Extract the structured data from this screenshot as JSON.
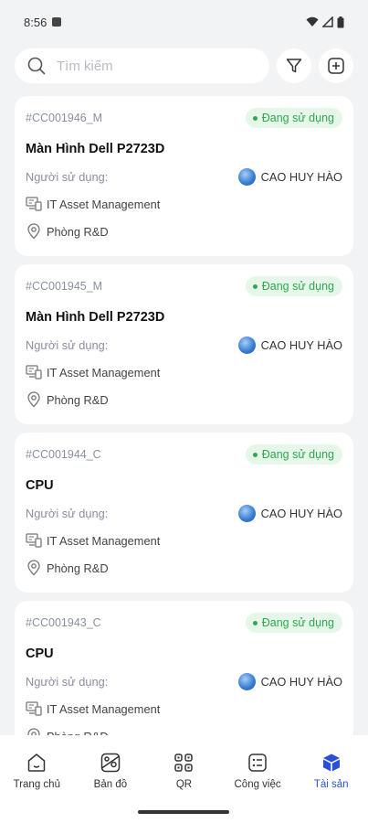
{
  "status_bar": {
    "time": "8:56"
  },
  "search": {
    "placeholder": "Tìm kiếm"
  },
  "cards": [
    {
      "code": "#CC001946_M",
      "status": "Đang sử dụng",
      "name": "Màn Hình Dell P2723D",
      "user_label": "Người sử dụng:",
      "user": "CAO HUY HÀO",
      "department": "IT Asset Management",
      "location": "Phòng R&D"
    },
    {
      "code": "#CC001945_M",
      "status": "Đang sử dụng",
      "name": "Màn Hình Dell P2723D",
      "user_label": "Người sử dụng:",
      "user": "CAO HUY HÀO",
      "department": "IT Asset Management",
      "location": "Phòng R&D"
    },
    {
      "code": "#CC001944_C",
      "status": "Đang sử dụng",
      "name": "CPU",
      "user_label": "Người sử dụng:",
      "user": "CAO HUY HÀO",
      "department": "IT Asset Management",
      "location": "Phòng R&D"
    },
    {
      "code": "#CC001943_C",
      "status": "Đang sử dụng",
      "name": "CPU",
      "user_label": "Người sử dụng:",
      "user": "CAO HUY HÀO",
      "department": "IT Asset Management",
      "location": "Phòng R&D"
    }
  ],
  "nav": [
    {
      "label": "Trang chủ",
      "icon": "home-icon"
    },
    {
      "label": "Bản đồ",
      "icon": "map-icon"
    },
    {
      "label": "QR",
      "icon": "qr-icon"
    },
    {
      "label": "Công việc",
      "icon": "tasks-icon"
    },
    {
      "label": "Tài sản",
      "icon": "assets-icon",
      "active": true
    }
  ],
  "colors": {
    "accent": "#2b4fd9",
    "status_green": "#2fa84f",
    "status_bg": "#e6f7e9"
  }
}
